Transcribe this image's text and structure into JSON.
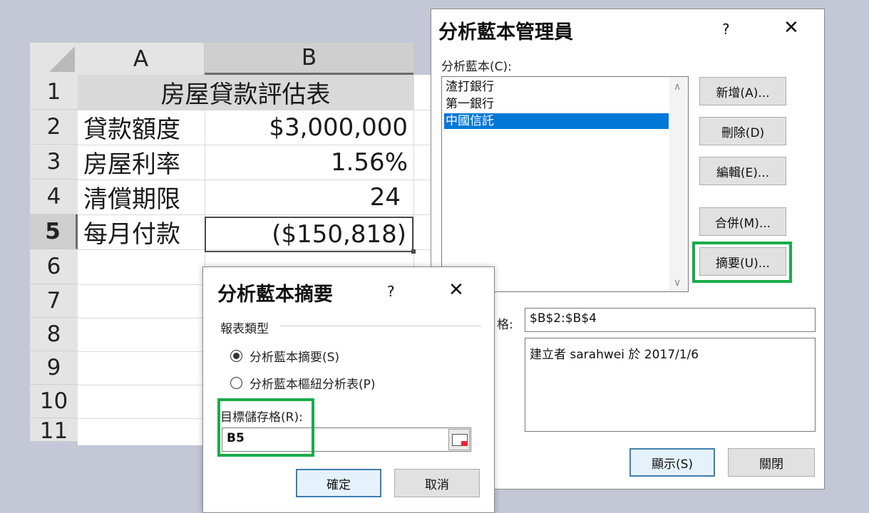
{
  "sheet": {
    "columns": [
      "A",
      "B"
    ],
    "rows": [
      "1",
      "2",
      "3",
      "4",
      "5",
      "6",
      "7",
      "8",
      "9",
      "10",
      "11"
    ],
    "title": "房屋貸款評估表",
    "labels": [
      "貸款額度",
      "房屋利率",
      "清償期限",
      "每月付款"
    ],
    "values": [
      "$3,000,000",
      "1.56%",
      "24",
      "($150,818)"
    ],
    "active_row": "5"
  },
  "manager": {
    "title": "分析藍本管理員",
    "help": "?",
    "close": "✕",
    "scenarios_label": "分析藍本(C):",
    "scenarios": [
      "渣打銀行",
      "第一銀行",
      "中國信託"
    ],
    "selected_scenario": "中國信託",
    "buttons": {
      "add": "新增(A)...",
      "delete": "刪除(D)",
      "edit": "編輯(E)...",
      "merge": "合併(M)...",
      "summary": "摘要(U)..."
    },
    "changing_cells_label": "格:",
    "changing_cells_value": "$B$2:$B$4",
    "comment": "建立者 sarahwei 於 2017/1/6",
    "show": "顯示(S)",
    "close_button": "關閉"
  },
  "summary": {
    "title": "分析藍本摘要",
    "help": "?",
    "close": "✕",
    "report_type_label": "報表類型",
    "option_summary": "分析藍本摘要(S)",
    "option_pivot": "分析藍本樞紐分析表(P)",
    "selected_option": "分析藍本摘要(S)",
    "result_cells_label": "目標儲存格(R):",
    "result_cells_value": "B5",
    "ok": "確定",
    "cancel": "取消"
  },
  "colors": {
    "highlight": "#1aab4a",
    "selection": "#0078d7",
    "background": "#c3c7d6"
  }
}
